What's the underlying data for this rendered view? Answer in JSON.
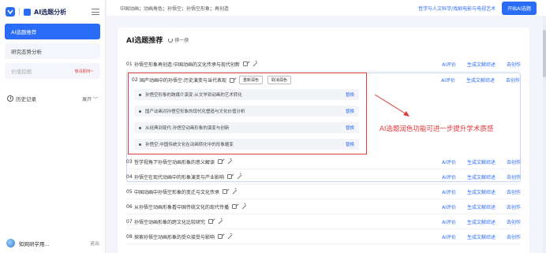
{
  "sidebar": {
    "app_title": "AI选题分析",
    "nav": [
      {
        "label": "AI选题推荐",
        "active": true
      },
      {
        "label": "研究态势分析",
        "active": false
      },
      {
        "label": "价值挖掘",
        "badge": "敬请期待~"
      }
    ],
    "history_label": "历史记录",
    "expand_label": "展开",
    "user_name": "知网研学用...",
    "logout_label": "退出"
  },
  "topbar": {
    "keywords": "中国动画；动画角色；孙悟空；孙悟空形象；再创造",
    "discipline": "哲学与人文科学/戏剧电影与电视艺术",
    "start_button": "开始AI选题"
  },
  "card": {
    "title": "AI选题推荐",
    "refresh_label": "换一换",
    "actions": {
      "evaluate": "AI评价",
      "generate": "生成文献综述",
      "create": "去创作"
    },
    "expanded": {
      "num": "02",
      "title": "国产动画中的孙悟空:历史演变与当代表现",
      "polish_button": "重新润色",
      "cancel_button": "取消润色",
      "subs": [
        "孙悟空形象的跨媒介演变:从文学到动画的艺术转化",
        "国产动画对孙悟空形象的现代化塑造与文化价值分析",
        "从经典到现代:孙悟空动画形象的演变与创新",
        "孙悟空:中国传统文化在动画转化中的形象嬗变"
      ],
      "swap_label": "替换"
    },
    "rows": [
      {
        "num": "01",
        "title": "孙悟空形象再创造:中国动画的文化传承与现代创新"
      },
      {
        "num": "03",
        "title": "哲学视角下孙悟空动画形象的意义解读"
      },
      {
        "num": "04",
        "title": "孙悟空在现代动画中的形象演变与产业影响"
      },
      {
        "num": "05",
        "title": "中国动画中孙悟空形象的变迁与文化传承"
      },
      {
        "num": "06",
        "title": "从孙悟空动画形象看中国传统文化的现代传播"
      },
      {
        "num": "07",
        "title": "孙悟空动画形象的跨文化比较研究"
      },
      {
        "num": "08",
        "title": "探索孙悟空动画形象的受众接受与影响"
      }
    ]
  },
  "annotation": "AI选题润色功能可进一步提升学术质感",
  "colors": {
    "accent": "#2b6cf6",
    "annotation": "#e23a3a"
  }
}
